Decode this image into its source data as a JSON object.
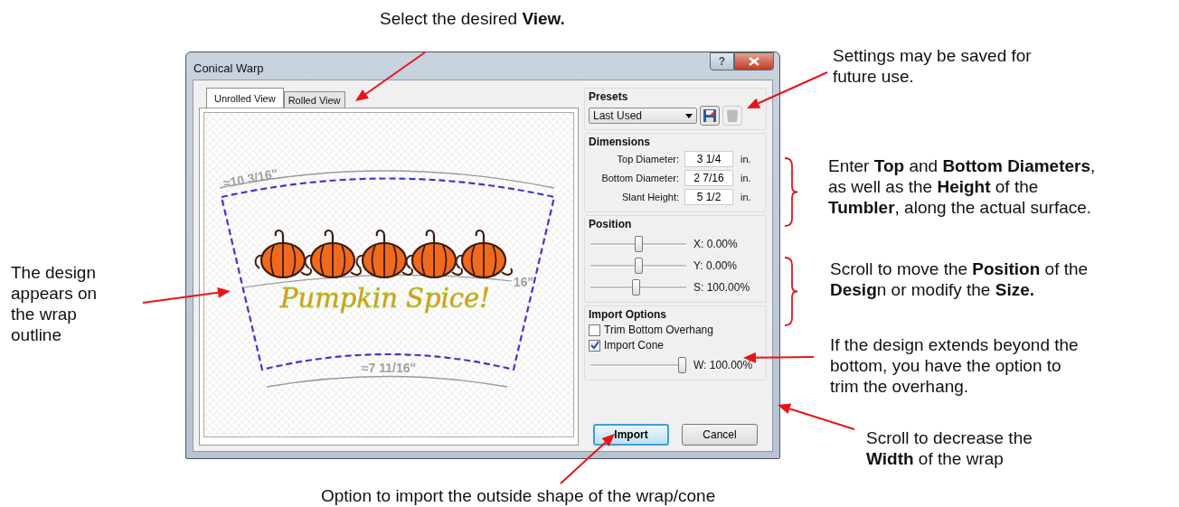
{
  "window": {
    "title": "Conical Warp",
    "title_buttons": [
      {
        "kind": "help",
        "label": "?"
      },
      {
        "kind": "close"
      }
    ]
  },
  "tabs": [
    {
      "label": "Unrolled View",
      "selected": true
    },
    {
      "label": "Rolled View",
      "selected": false
    }
  ],
  "preview": {
    "top_measure": "≈10 3/16\"",
    "bottom_measure": "≈7 11/16\"",
    "side_measure": "16\"",
    "design_text": "Pumpkin Spice!"
  },
  "presets": {
    "title": "Presets",
    "value": "Last Used",
    "save_disabled": false,
    "delete_disabled": true
  },
  "dimensions": {
    "title": "Dimensions",
    "fields": [
      {
        "label": "Top Diameter:",
        "value": "3 1/4",
        "unit": "in."
      },
      {
        "label": "Bottom Diameter:",
        "value": "2 7/16",
        "unit": "in."
      },
      {
        "label": "Slant Height:",
        "value": "5 1/2",
        "unit": "in."
      }
    ]
  },
  "position": {
    "title": "Position",
    "sliders": [
      {
        "level": 0.5,
        "reading": "X: 0.00%"
      },
      {
        "level": 0.5,
        "reading": "Y: 0.00%"
      },
      {
        "level": 0.47,
        "reading": "S: 100.00%"
      }
    ]
  },
  "import_options": {
    "title": "Import Options",
    "checkboxes": [
      {
        "label": "Trim Bottom Overhang",
        "checked": false
      },
      {
        "label": "Import Cone",
        "checked": true
      }
    ],
    "width_slider": {
      "level": 1,
      "reading": "W: 100.00%"
    }
  },
  "buttons": [
    {
      "label": "Import",
      "default": true
    },
    {
      "label": "Cancel",
      "default": false
    }
  ],
  "annotations": [
    {
      "lines": [
        "Select the desired **View.**"
      ]
    },
    {
      "lines": [
        "Settings may be saved for",
        "future use."
      ]
    },
    {
      "lines": [
        "Enter **Top** and **Bottom Diameters**,",
        "as well as the **Height** of the",
        "**Tumbler**, along the actual surface."
      ]
    },
    {
      "lines": [
        "Scroll to move the **Position** of the",
        "**Desig**n or modify the **Size.**"
      ]
    },
    {
      "lines": [
        "If the design extends beyond the",
        "bottom, you have the option to",
        "trim the overhang."
      ]
    },
    {
      "lines": [
        "Scroll to decrease the",
        "**Width** of the wrap"
      ]
    },
    {
      "lines": [
        "Option to import the outside shape of the wrap/cone"
      ]
    },
    {
      "lines": [
        "The design",
        "appears on",
        "the wrap",
        "outline"
      ]
    }
  ]
}
